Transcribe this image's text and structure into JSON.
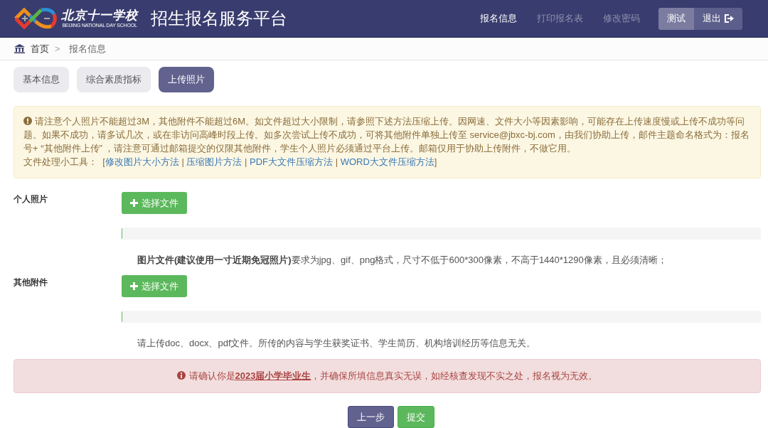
{
  "header": {
    "logo_name": "北京十一学校",
    "logo_subtitle": "BEIJING NATIONAL DAY SCHOOL",
    "title": "招生报名服务平台",
    "nav": [
      {
        "label": "报名信息",
        "selected": true
      },
      {
        "label": "打印报名表",
        "selected": false
      },
      {
        "label": "修改密码",
        "selected": false
      }
    ],
    "user": "测试",
    "logout": "退出"
  },
  "breadcrumb": [
    {
      "label": "首页"
    },
    {
      "label": ">"
    },
    {
      "label": "报名信息"
    }
  ],
  "tabs": [
    {
      "label": "基本信息",
      "selected": false
    },
    {
      "label": "综合素质指标",
      "selected": false
    },
    {
      "label": "上传照片",
      "selected": true
    }
  ],
  "notice": {
    "text": "请注意个人照片不能超过3M，其他附件不能超过6M。如文件超过大小限制，请参照下述方法压缩上传。因网速、文件大小等因素影响，可能存在上传速度慢或上传不成功等问题。如果不成功，请多试几次，或在非访问高峰时段上传。如多次尝试上传不成功，可将其他附件单独上传至 service@jbxc-bj.com，由我们协助上传，邮件主题命名格式为：报名号+ “其他附件上传” ，请注意可通过邮箱提交的仅限其他附件，学生个人照片必须通过平台上传。邮箱仅用于协助上传附件，不做它用。",
    "tools": [
      {
        "kind": "text",
        "text": "文件处理小工具：  ["
      },
      {
        "kind": "link",
        "text": "修改图片大小方法"
      },
      {
        "kind": "text",
        "text": " | "
      },
      {
        "kind": "link",
        "text": "压缩图片方法"
      },
      {
        "kind": "text",
        "text": " | "
      },
      {
        "kind": "link",
        "text": "PDF大文件压缩方法"
      },
      {
        "kind": "text",
        "text": " | "
      },
      {
        "kind": "link",
        "text": "WORD大文件压缩方法"
      },
      {
        "kind": "text",
        "text": "]"
      }
    ]
  },
  "uploads": [
    {
      "label": "个人照片",
      "button": "选择文件",
      "level": 0,
      "help": "**图片文件(建议使用一寸近期免冠照片)**要求为jpg、gif、png格式，尺寸不低于600*300像素，不高于1440*1290像素，且必须清晰；"
    },
    {
      "label": "其他附件",
      "button": "选择文件",
      "level": 0,
      "help": "请上传doc、docx、pdf文件。所传的内容与学生获奖证书、学生简历、机构培训经历等信息无关。"
    }
  ],
  "alert": "请确认你是**2023届小学毕业生**，并确保所填信息真实无误，如经核查发现不实之处，报名视为无效。",
  "actions": [
    {
      "label": "上一步",
      "kind": "secondary"
    },
    {
      "label": "提交",
      "kind": "primary"
    }
  ]
}
